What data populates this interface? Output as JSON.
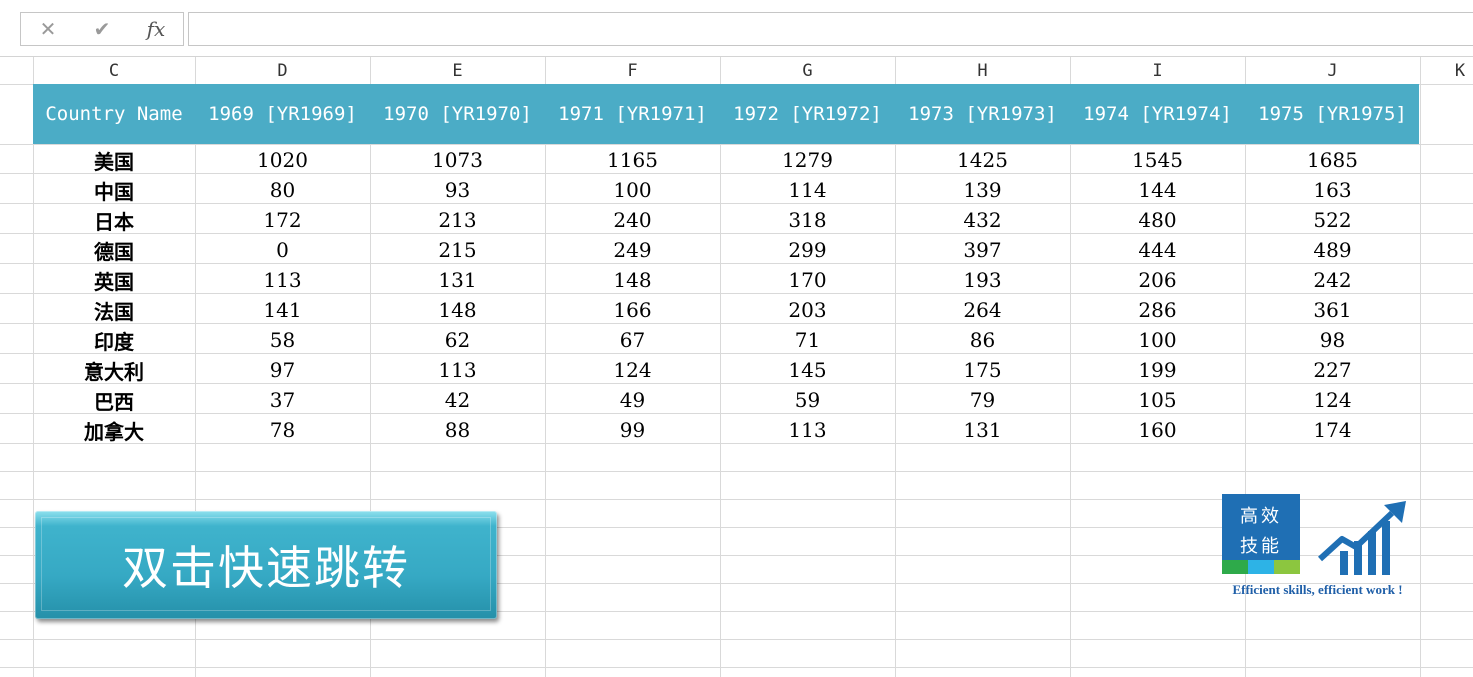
{
  "formula_bar": {
    "cancel_icon": "✕",
    "enter_icon": "✔",
    "function_icon": "fx",
    "value": ""
  },
  "columns": [
    "C",
    "D",
    "E",
    "F",
    "G",
    "H",
    "I",
    "J",
    "K"
  ],
  "table": {
    "headers": [
      "Country Name",
      "1969 [YR1969]",
      "1970 [YR1970]",
      "1971 [YR1971]",
      "1972 [YR1972]",
      "1973 [YR1973]",
      "1974 [YR1974]",
      "1975 [YR1975]"
    ],
    "rows": [
      [
        "美国",
        "1020",
        "1073",
        "1165",
        "1279",
        "1425",
        "1545",
        "1685"
      ],
      [
        "中国",
        "80",
        "93",
        "100",
        "114",
        "139",
        "144",
        "163"
      ],
      [
        "日本",
        "172",
        "213",
        "240",
        "318",
        "432",
        "480",
        "522"
      ],
      [
        "德国",
        "0",
        "215",
        "249",
        "299",
        "397",
        "444",
        "489"
      ],
      [
        "英国",
        "113",
        "131",
        "148",
        "170",
        "193",
        "206",
        "242"
      ],
      [
        "法国",
        "141",
        "148",
        "166",
        "203",
        "264",
        "286",
        "361"
      ],
      [
        "印度",
        "58",
        "62",
        "67",
        "71",
        "86",
        "100",
        "98"
      ],
      [
        "意大利",
        "97",
        "113",
        "124",
        "145",
        "175",
        "199",
        "227"
      ],
      [
        "巴西",
        "37",
        "42",
        "49",
        "59",
        "79",
        "105",
        "124"
      ],
      [
        "加拿大",
        "78",
        "88",
        "99",
        "113",
        "131",
        "160",
        "174"
      ]
    ]
  },
  "button": {
    "label": "双击快速跳转"
  },
  "logo": {
    "line1": "高效",
    "line2": "技能",
    "tagline": "Efficient skills, efficient work !",
    "colors": {
      "box": "#1f6fb4",
      "stripes": [
        "#2eaa4a",
        "#2db3e6",
        "#8cc63f"
      ]
    }
  },
  "colors": {
    "header_fill": "#4bacc6",
    "header_text": "#ffffff",
    "button_fill": "#36a9c4"
  }
}
